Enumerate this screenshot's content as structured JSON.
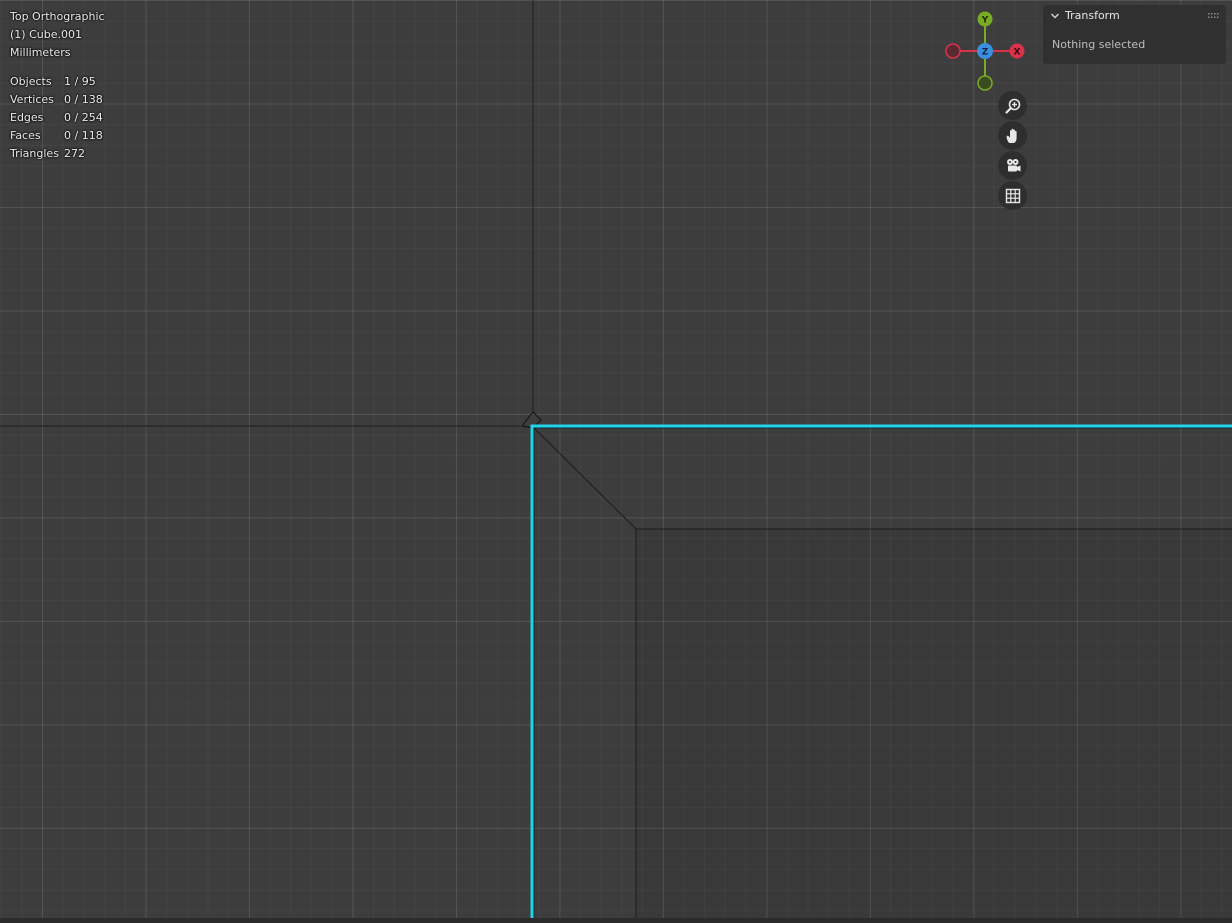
{
  "viewport": {
    "view_name": "Top Orthographic",
    "active_object": "(1) Cube.001",
    "units": "Millimeters",
    "selection_color": "#22d3e8"
  },
  "stats": [
    {
      "label": "Objects",
      "value": "1 / 95"
    },
    {
      "label": "Vertices",
      "value": "0 / 138"
    },
    {
      "label": "Edges",
      "value": "0 / 254"
    },
    {
      "label": "Faces",
      "value": "0 / 118"
    },
    {
      "label": "Triangles",
      "value": "272"
    }
  ],
  "gizmo": {
    "axes": {
      "y": "Y",
      "z": "Z",
      "x": "X"
    },
    "colors": {
      "x": "#d8334a",
      "y": "#7aab25",
      "z": "#3c8fe0"
    }
  },
  "nav_buttons": [
    {
      "name": "zoom-button",
      "icon": "zoom-in-icon"
    },
    {
      "name": "pan-button",
      "icon": "hand-icon"
    },
    {
      "name": "camera-view-button",
      "icon": "camera-icon"
    },
    {
      "name": "perspective-toggle-button",
      "icon": "grid-icon"
    }
  ],
  "sidebar_panel": {
    "title": "Transform",
    "empty_message": "Nothing selected"
  }
}
